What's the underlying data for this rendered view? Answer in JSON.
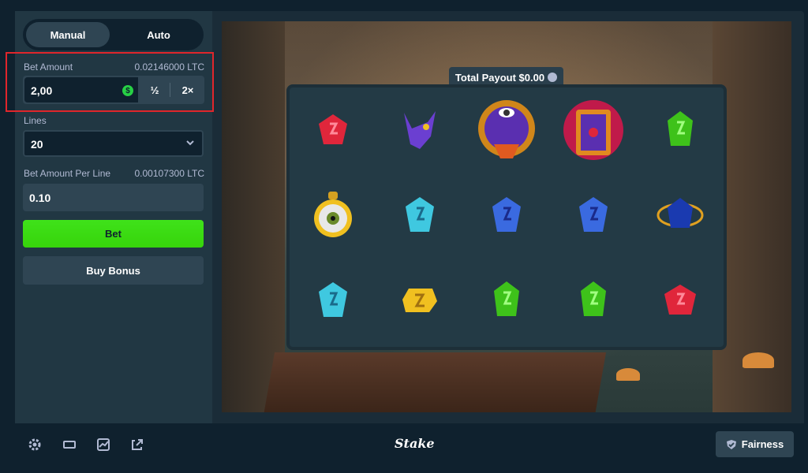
{
  "tabs": {
    "manual": "Manual",
    "auto": "Auto"
  },
  "bet_amount": {
    "label": "Bet Amount",
    "crypto_value": "0.02146000 LTC",
    "value": "2,00",
    "currency_symbol": "$",
    "half_label": "½",
    "double_label": "2×"
  },
  "lines": {
    "label": "Lines",
    "value": "20"
  },
  "per_line": {
    "label": "Bet Amount Per Line",
    "crypto_value": "0.00107300 LTC",
    "value": "0.10"
  },
  "buttons": {
    "bet": "Bet",
    "buy_bonus": "Buy Bonus"
  },
  "game": {
    "total_payout": "Total Payout $0.00"
  },
  "grid": [
    [
      "red-gem",
      "purple-creature",
      "eye-portal",
      "book-portal",
      "green-gem"
    ],
    [
      "eyeball-charm",
      "cyan-gem",
      "blue-gem",
      "blue-gem",
      "blue-orb"
    ],
    [
      "cyan-gem",
      "yellow-gem",
      "green-gem",
      "green-gem",
      "red-gem"
    ]
  ],
  "footer": {
    "logo": "Stake",
    "fairness": "Fairness",
    "icons": [
      "gear-icon",
      "theater-icon",
      "stats-icon",
      "popout-icon"
    ]
  },
  "colors": {
    "accent": "#1fff20",
    "bg": "#0f212e",
    "panel": "#213743",
    "highlight": "#e0262b"
  }
}
